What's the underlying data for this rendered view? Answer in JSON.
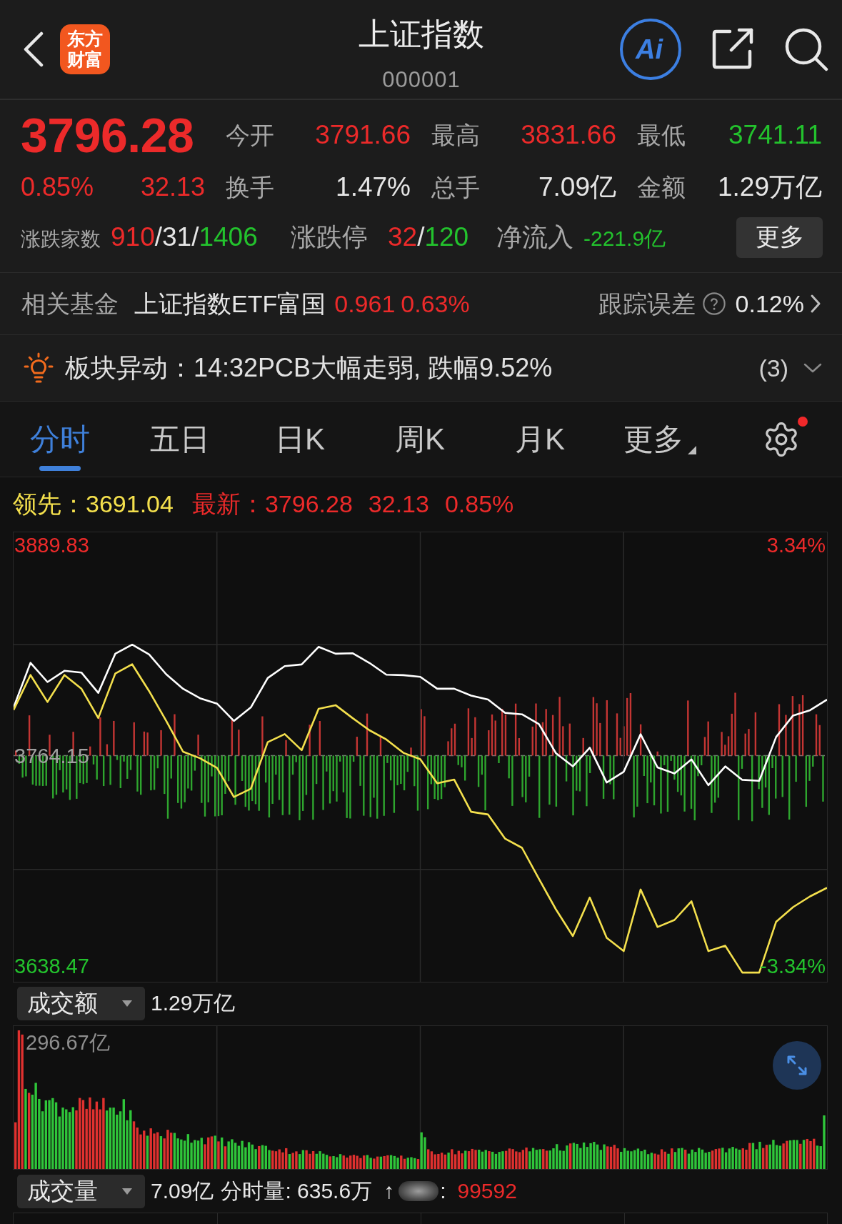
{
  "header": {
    "logo": [
      "东方",
      "财富"
    ],
    "title": "上证指数",
    "code": "000001",
    "ai_label": "Ai"
  },
  "quote": {
    "price": "3796.28",
    "change_percent": "0.85%",
    "change": "32.13",
    "color": "#ec2a2a",
    "stats": [
      {
        "label": "今开",
        "value": "3791.66",
        "color": "#ec2a2a"
      },
      {
        "label": "最高",
        "value": "3831.66",
        "color": "#ec2a2a"
      },
      {
        "label": "最低",
        "value": "3741.11",
        "color": "#23c22d"
      },
      {
        "label": "换手",
        "value": "1.47%",
        "color": "#e6e6e6"
      },
      {
        "label": "总手",
        "value": "7.09亿",
        "color": "#e6e6e6"
      },
      {
        "label": "金额",
        "value": "1.29万亿",
        "color": "#e6e6e6"
      }
    ],
    "breadth": [
      {
        "kind": "counts",
        "label": "涨跌家数",
        "parts": [
          {
            "text": "910",
            "color": "#ec2a2a"
          },
          {
            "text": "/31/",
            "color": "#e6e6e6"
          },
          {
            "text": "1406",
            "color": "#23c22d"
          }
        ]
      },
      {
        "kind": "limits",
        "label": "涨跌停",
        "parts": [
          {
            "text": "32",
            "color": "#ec2a2a"
          },
          {
            "text": "/",
            "color": "#e6e6e6"
          },
          {
            "text": "120",
            "color": "#23c22d"
          }
        ]
      },
      {
        "kind": "flow",
        "label": "净流入",
        "parts": [
          {
            "text": "-221.9亿",
            "color": "#23c22d"
          }
        ]
      }
    ],
    "more_button": "更多"
  },
  "fund": {
    "label": "相关基金",
    "name": "上证指数ETF富国",
    "price": "0.961",
    "change": "0.63%",
    "color": "#ec2a2a",
    "tracking_label": "跟踪误差",
    "tracking_value": "0.12%"
  },
  "alert": {
    "text": "板块异动：14:32PCB大幅走弱, 跌幅9.52%",
    "count": "(3)",
    "expanded": false
  },
  "tabs": [
    {
      "label": "分时",
      "kind": "period",
      "selected": true
    },
    {
      "label": "五日",
      "kind": "period",
      "selected": false
    },
    {
      "label": "日K",
      "kind": "period",
      "selected": false
    },
    {
      "label": "周K",
      "kind": "period",
      "selected": false
    },
    {
      "label": "月K",
      "kind": "period",
      "selected": false
    },
    {
      "label": "更多",
      "kind": "menu",
      "selected": false
    }
  ],
  "settings": {
    "notification_dot": true
  },
  "legend": [
    {
      "label": "领先：",
      "color": "#f4e04d",
      "values": [
        "3691.04"
      ]
    },
    {
      "label": "最新：",
      "color": "#ec2a2a",
      "values": [
        "3796.28",
        "32.13",
        "0.85%"
      ]
    }
  ],
  "main_chart": {
    "percent_labels": [
      {
        "text": "3.34%",
        "color": "#ec2a2a"
      },
      {
        "text": "-3.34%",
        "color": "#23c22d"
      }
    ],
    "chart_data": {
      "type": "line",
      "grid": true,
      "categories": [
        null,
        null,
        null,
        null,
        null,
        null,
        null,
        null,
        null,
        null,
        null,
        null,
        null,
        null,
        null,
        null,
        null,
        null,
        null,
        null,
        null,
        null,
        null,
        null,
        null,
        null,
        null,
        null,
        null,
        null,
        null,
        null,
        null,
        null,
        null,
        null,
        null,
        null,
        null,
        null,
        null,
        null,
        null,
        null,
        null,
        null,
        null,
        null,
        null
      ],
      "ylim": [
        3629.1,
        3897.5
      ],
      "yticks": [
        {
          "value": 3638.47,
          "label": "3638.47"
        },
        {
          "value": 3764.15,
          "label": "3764.15"
        },
        {
          "value": 3889.83,
          "label": "3889.83"
        }
      ],
      "series": [
        {
          "color": "#ffffff",
          "values": [
            3792.9,
            3819.6,
            3808.1,
            3814.8,
            3813.8,
            3801.6,
            3825.0,
            3830.4,
            3824.6,
            3812.8,
            3804.1,
            3798.4,
            3795.2,
            3784.9,
            3792.9,
            3810.5,
            3817.6,
            3818.6,
            3829.1,
            3825.0,
            3825.3,
            3819.5,
            3812.5,
            3812.2,
            3811.2,
            3804.1,
            3804.1,
            3800.0,
            3797.7,
            3789.7,
            3788.8,
            3783.0,
            3765.7,
            3757.7,
            3768.9,
            3748.1,
            3754.5,
            3776.9,
            3757.1,
            3753.5,
            3761.9,
            3746.5,
            3757.7,
            3749.7,
            3749.1,
            3775.3,
            3788.1,
            3791.3,
            3797.6
          ]
        },
        {
          "color": "#f4e04d",
          "values": [
            3791.4,
            3812.3,
            3796.2,
            3812.3,
            3804.2,
            3786.6,
            3813.2,
            3818.7,
            3802.7,
            3785.0,
            3766.5,
            3762.6,
            3756.8,
            3739.5,
            3744.4,
            3772.2,
            3777.0,
            3767.4,
            3792.1,
            3794.3,
            3786.6,
            3779.3,
            3773.8,
            3765.8,
            3762.0,
            3747.6,
            3749.8,
            3730.6,
            3729.0,
            3714.6,
            3709.1,
            3690.6,
            3672.4,
            3656.4,
            3679.4,
            3655.4,
            3647.4,
            3684.2,
            3661.8,
            3666.0,
            3677.2,
            3647.4,
            3650.6,
            3634.6,
            3634.6,
            3665.0,
            3673.7,
            3680.1,
            3685.2
          ]
        }
      ]
    }
  },
  "volume_panel": {
    "selector": "成交额",
    "total": "1.29万亿",
    "max_label": "296.67亿"
  },
  "volume_count_row": {
    "selector": "成交量",
    "total": "7.09亿",
    "minute_volume": "分时量: 635.6万",
    "arrow": "↑",
    "separator": ":",
    "count": {
      "text": "99592",
      "color": "#ec2a2a"
    }
  }
}
